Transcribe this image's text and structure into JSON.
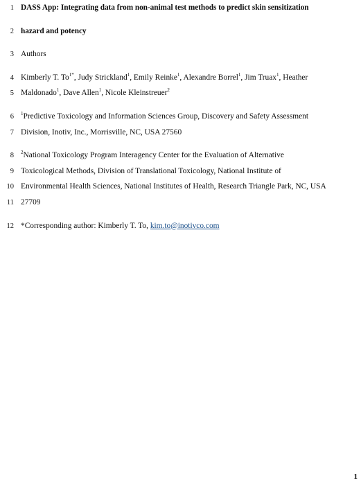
{
  "document": {
    "page_number": "1",
    "link_color": "#1a4f8a",
    "lines": [
      {
        "number": "1",
        "style": "bold",
        "gap_before": false,
        "segments": [
          {
            "type": "text",
            "text": "DASS App: Integrating data from non-animal test methods to predict skin sensitization"
          }
        ]
      },
      {
        "number": "2",
        "style": "bold",
        "gap_before": true,
        "segments": [
          {
            "type": "text",
            "text": "hazard and potency"
          }
        ]
      },
      {
        "number": "3",
        "style": "normal",
        "gap_before": true,
        "segments": [
          {
            "type": "text",
            "text": "Authors"
          }
        ]
      },
      {
        "number": "4",
        "style": "normal",
        "gap_before": true,
        "segments": [
          {
            "type": "text",
            "text": "Kimberly T. To"
          },
          {
            "type": "sup",
            "text": "1*"
          },
          {
            "type": "text",
            "text": ", Judy Strickland"
          },
          {
            "type": "sup",
            "text": "1"
          },
          {
            "type": "text",
            "text": ", Emily Reinke"
          },
          {
            "type": "sup",
            "text": "1"
          },
          {
            "type": "text",
            "text": ", Alexandre Borrel"
          },
          {
            "type": "sup",
            "text": "1"
          },
          {
            "type": "text",
            "text": ", Jim Truax"
          },
          {
            "type": "sup",
            "text": "1"
          },
          {
            "type": "text",
            "text": ", Heather"
          }
        ]
      },
      {
        "number": "5",
        "style": "normal",
        "gap_before": false,
        "segments": [
          {
            "type": "text",
            "text": "Maldonado"
          },
          {
            "type": "sup",
            "text": "1"
          },
          {
            "type": "text",
            "text": ", Dave Allen"
          },
          {
            "type": "sup",
            "text": "1"
          },
          {
            "type": "text",
            "text": ", Nicole Kleinstreuer"
          },
          {
            "type": "sup",
            "text": "2"
          }
        ]
      },
      {
        "number": "6",
        "style": "normal",
        "gap_before": true,
        "segments": [
          {
            "type": "sup",
            "text": "1"
          },
          {
            "type": "text",
            "text": "Predictive Toxicology and Information Sciences Group, Discovery and Safety Assessment"
          }
        ]
      },
      {
        "number": "7",
        "style": "normal",
        "gap_before": false,
        "segments": [
          {
            "type": "text",
            "text": "Division, Inotiv, Inc., Morrisville, NC, USA 27560"
          }
        ]
      },
      {
        "number": "8",
        "style": "normal",
        "gap_before": true,
        "segments": [
          {
            "type": "sup",
            "text": "2"
          },
          {
            "type": "text",
            "text": "National Toxicology Program Interagency Center for the Evaluation of Alternative"
          }
        ]
      },
      {
        "number": "9",
        "style": "normal",
        "gap_before": false,
        "segments": [
          {
            "type": "text",
            "text": "Toxicological Methods, Division of Translational Toxicology, National Institute of"
          }
        ]
      },
      {
        "number": "10",
        "style": "normal",
        "gap_before": false,
        "segments": [
          {
            "type": "text",
            "text": "Environmental Health Sciences, National Institutes of Health, Research Triangle Park, NC, USA"
          }
        ]
      },
      {
        "number": "11",
        "style": "normal",
        "gap_before": false,
        "segments": [
          {
            "type": "text",
            "text": "27709"
          }
        ]
      },
      {
        "number": "12",
        "style": "normal",
        "gap_before": true,
        "segments": [
          {
            "type": "text",
            "text": "*Corresponding author: Kimberly T. To, "
          },
          {
            "type": "link",
            "text": "kim.to@inotivco.com"
          }
        ]
      }
    ]
  }
}
